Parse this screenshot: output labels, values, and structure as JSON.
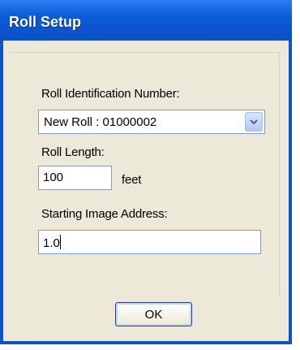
{
  "window": {
    "title": "Roll Setup"
  },
  "form": {
    "roll_id_label": "Roll Identification Number:",
    "roll_id_value": "New Roll : 01000002",
    "roll_length_label": "Roll Length:",
    "roll_length_value": "100",
    "roll_length_unit": "feet",
    "start_address_label": "Starting Image Address:",
    "start_address_value": "1.0"
  },
  "buttons": {
    "ok_label": "OK"
  },
  "icons": {
    "dropdown": "chevron-down-icon"
  },
  "colors": {
    "titlebar": "#0a53c8",
    "client_bg": "#ece9d8",
    "input_border": "#7f9db9"
  }
}
